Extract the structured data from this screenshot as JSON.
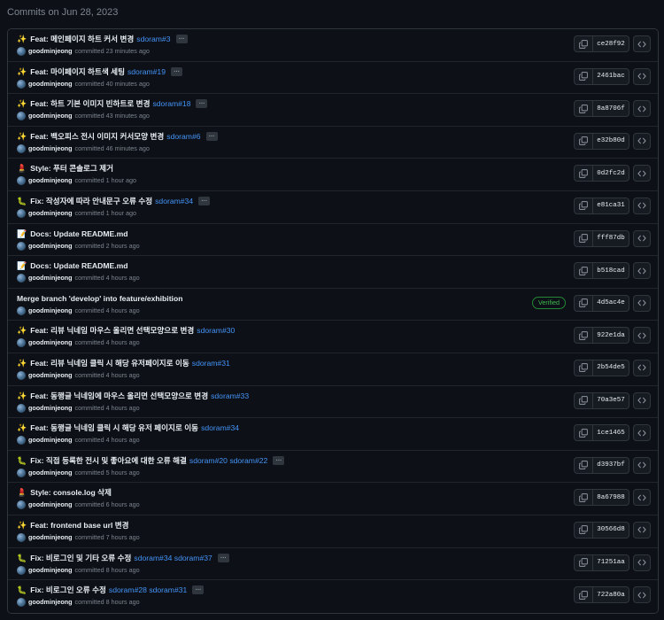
{
  "header": {
    "title": "Commits on Jun 28, 2023"
  },
  "icons": {
    "copy": "copy-icon",
    "browse": "code-icon",
    "avatar": "avatar",
    "more": "ellipsis-icon"
  },
  "colors": {
    "background": "#0d1117",
    "link": "#4493f8",
    "verified": "#3fb950",
    "muted": "#7d8590"
  },
  "commits": [
    {
      "emoji": "✨",
      "title": "Feat: 메인페이지 하트 커서 변경",
      "refs": [
        "sdoram#3"
      ],
      "more": true,
      "author": "goodminjeong",
      "time": "committed 23 minutes ago",
      "sha": "ce28f92",
      "verified": ""
    },
    {
      "emoji": "✨",
      "title": "Feat: 마이페이지 하트색 세팅",
      "refs": [
        "sdoram#19"
      ],
      "more": true,
      "author": "goodminjeong",
      "time": "committed 40 minutes ago",
      "sha": "2461bac",
      "verified": ""
    },
    {
      "emoji": "✨",
      "title": "Feat: 하트 기본 이미지 빈하트로 변경",
      "refs": [
        "sdoram#18"
      ],
      "more": true,
      "author": "goodminjeong",
      "time": "committed 43 minutes ago",
      "sha": "8a8706f",
      "verified": ""
    },
    {
      "emoji": "✨",
      "title": "Feat: 백오피스 전시 이미지 커서모양 변경",
      "refs": [
        "sdoram#6"
      ],
      "more": true,
      "author": "goodminjeong",
      "time": "committed 46 minutes ago",
      "sha": "e32b80d",
      "verified": ""
    },
    {
      "emoji": "💄",
      "title": "Style: 푸터 콘솔로그 제거",
      "refs": [],
      "more": false,
      "author": "goodminjeong",
      "time": "committed 1 hour ago",
      "sha": "0d2fc2d",
      "verified": ""
    },
    {
      "emoji": "🐛",
      "title": "Fix: 작성자에 따라 안내문구 오류 수정",
      "refs": [
        "sdoram#34"
      ],
      "more": true,
      "author": "goodminjeong",
      "time": "committed 1 hour ago",
      "sha": "e81ca31",
      "verified": ""
    },
    {
      "emoji": "📝",
      "title": "Docs: Update README.md",
      "refs": [],
      "more": false,
      "author": "goodminjeong",
      "time": "committed 2 hours ago",
      "sha": "fff87db",
      "verified": ""
    },
    {
      "emoji": "📝",
      "title": "Docs: Update README.md",
      "refs": [],
      "more": false,
      "author": "goodminjeong",
      "time": "committed 4 hours ago",
      "sha": "b518cad",
      "verified": ""
    },
    {
      "emoji": "",
      "title": "Merge branch 'develop' into feature/exhibition",
      "refs": [],
      "more": false,
      "author": "goodminjeong",
      "time": "committed 4 hours ago",
      "sha": "4d5ac4e",
      "verified": "Verified"
    },
    {
      "emoji": "✨",
      "title": "Feat: 리뷰 닉네임 마우스 올리면 선택모양으로 변경",
      "refs": [
        "sdoram#30"
      ],
      "more": false,
      "author": "goodminjeong",
      "time": "committed 4 hours ago",
      "sha": "922e1da",
      "verified": ""
    },
    {
      "emoji": "✨",
      "title": "Feat: 리뷰 닉네임 클릭 시 해당 유저페이지로 이동",
      "refs": [
        "sdoram#31"
      ],
      "more": false,
      "author": "goodminjeong",
      "time": "committed 4 hours ago",
      "sha": "2b54de5",
      "verified": ""
    },
    {
      "emoji": "✨",
      "title": "Feat: 동행글 닉네임에 마우스 올리면 선택모양으로 변경",
      "refs": [
        "sdoram#33"
      ],
      "more": false,
      "author": "goodminjeong",
      "time": "committed 4 hours ago",
      "sha": "70a3e57",
      "verified": ""
    },
    {
      "emoji": "✨",
      "title": "Feat: 동행글 닉네임 클릭 시 해당 유저 페이지로 이동",
      "refs": [
        "sdoram#34"
      ],
      "more": false,
      "author": "goodminjeong",
      "time": "committed 4 hours ago",
      "sha": "1ce1465",
      "verified": ""
    },
    {
      "emoji": "🐛",
      "title": "Fix: 직접 등록한 전시 및 좋아요에 대한 오류 해결",
      "refs": [
        "sdoram#20",
        "sdoram#22"
      ],
      "more": true,
      "author": "goodminjeong",
      "time": "committed 5 hours ago",
      "sha": "d3937bf",
      "verified": ""
    },
    {
      "emoji": "💄",
      "title": "Style: console.log 삭제",
      "refs": [],
      "more": false,
      "author": "goodminjeong",
      "time": "committed 6 hours ago",
      "sha": "8a67988",
      "verified": ""
    },
    {
      "emoji": "✨",
      "title": "Feat: frontend base url 변경",
      "refs": [],
      "more": false,
      "author": "goodminjeong",
      "time": "committed 7 hours ago",
      "sha": "30566d8",
      "verified": ""
    },
    {
      "emoji": "🐛",
      "title": "Fix: 비로그인 및 기타 오류 수정",
      "refs": [
        "sdoram#34",
        "sdoram#37"
      ],
      "more": true,
      "author": "goodminjeong",
      "time": "committed 8 hours ago",
      "sha": "71251aa",
      "verified": ""
    },
    {
      "emoji": "🐛",
      "title": "Fix: 비로그인 오류 수정",
      "refs": [
        "sdoram#28",
        "sdoram#31"
      ],
      "more": true,
      "author": "goodminjeong",
      "time": "committed 8 hours ago",
      "sha": "722a80a",
      "verified": ""
    }
  ]
}
